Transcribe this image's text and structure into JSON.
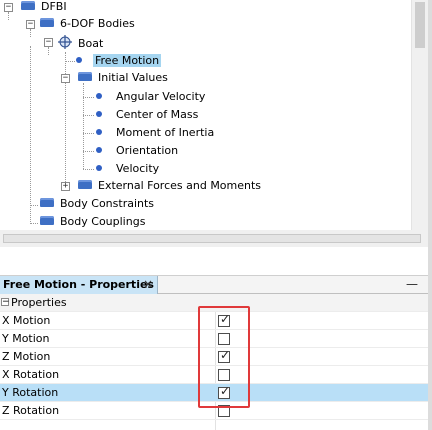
{
  "tree": {
    "root": {
      "label": "DFBI"
    },
    "bodies": {
      "label": "6-DOF Bodies"
    },
    "boat": {
      "label": "Boat"
    },
    "free_motion": {
      "label": "Free Motion"
    },
    "initial_values": {
      "label": "Initial Values",
      "children": [
        "Angular Velocity",
        "Center of Mass",
        "Moment of Inertia",
        "Orientation",
        "Velocity"
      ]
    },
    "external": {
      "label": "External Forces and Moments"
    },
    "constraints": {
      "label": "Body Constraints"
    },
    "couplings": {
      "label": "Body Couplings"
    }
  },
  "panel": {
    "tab_title": "Free Motion - Properties",
    "close_glyph": "×",
    "minimize_glyph": "—",
    "section_label": "Properties",
    "section_toggle": "−"
  },
  "properties": [
    {
      "label": "X Motion",
      "checked": true
    },
    {
      "label": "Y Motion",
      "checked": false
    },
    {
      "label": "Z Motion",
      "checked": true
    },
    {
      "label": "X Rotation",
      "checked": false
    },
    {
      "label": "Y Rotation",
      "checked": true
    },
    {
      "label": "Z Rotation",
      "checked": false
    }
  ],
  "colors": {
    "highlight": "#a5d5f0",
    "selected_row": "#b9dff7",
    "tab_bg": "#c9e4f6",
    "annotation_red": "#e0393a",
    "folder_blue": "#3e6fc4"
  }
}
